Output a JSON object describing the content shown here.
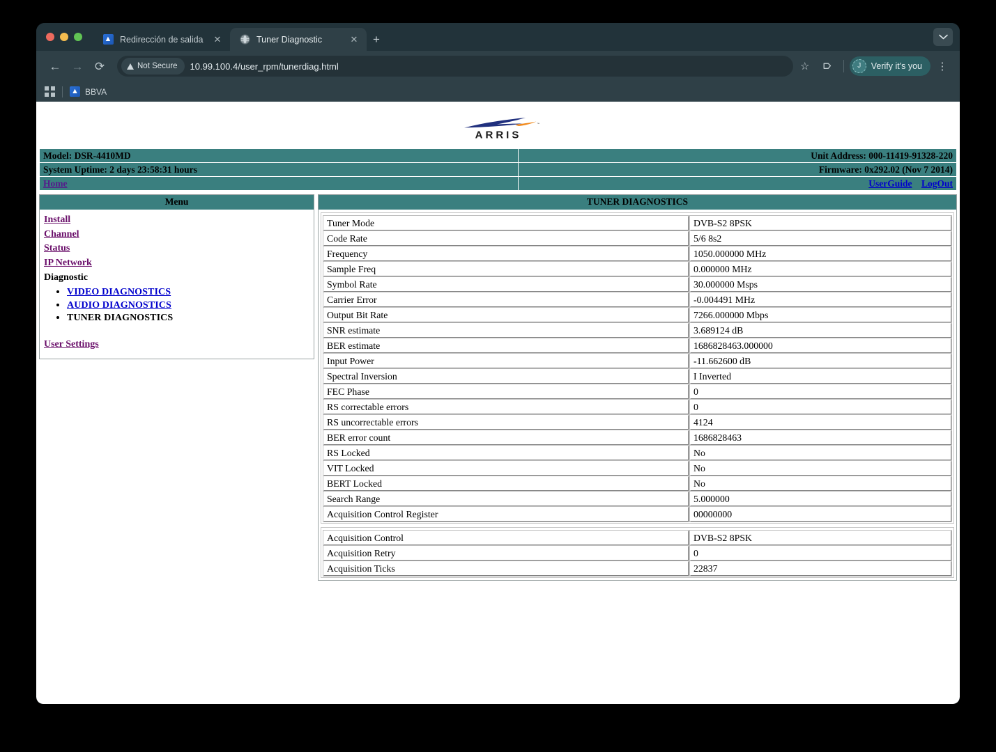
{
  "browser": {
    "tabs": [
      {
        "title": "Redirección de salida",
        "favicon": "bbva-icon",
        "active": false,
        "close_label": "✕"
      },
      {
        "title": "Tuner Diagnostic",
        "favicon": "globe-icon",
        "active": true,
        "close_label": "✕"
      }
    ],
    "new_tab_label": "+",
    "tabstrip_chevron": "⌄",
    "toolbar": {
      "back": "←",
      "forward": "→",
      "reload": "⟳",
      "security_label": "Not Secure",
      "url": "10.99.100.4/user_rpm/tunerdiag.html",
      "bookmark_star": "☆",
      "extensions": "❐",
      "profile_initial": "J",
      "profile_label": "Verify it's you",
      "menu": "⋮"
    },
    "bookmarks": {
      "apps_label": "apps-grid-icon",
      "items": [
        {
          "label": "BBVA",
          "favicon": "bbva-icon"
        }
      ]
    }
  },
  "page": {
    "logo": {
      "text": "ARRIS",
      "trademark": "™"
    },
    "info": {
      "model": "Model: DSR-4410MD",
      "unit_address": "Unit Address: 000-11419-91328-220",
      "uptime": "System Uptime: 2 days 23:58:31 hours",
      "firmware": "Firmware: 0x292.02 (Nov 7 2014)",
      "home": "Home",
      "user_guide": "UserGuide",
      "logout": "LogOut"
    },
    "menu": {
      "title": "Menu",
      "links": [
        {
          "label": "Install",
          "type": "link"
        },
        {
          "label": "Channel",
          "type": "link"
        },
        {
          "label": "Status",
          "type": "link"
        },
        {
          "label": "IP Network",
          "type": "link"
        }
      ],
      "diagnostic_heading": "Diagnostic",
      "diagnostic_items": [
        {
          "label": "VIDEO DIAGNOSTICS",
          "current": false
        },
        {
          "label": "AUDIO DIAGNOSTICS",
          "current": false
        },
        {
          "label": "TUNER DIAGNOSTICS",
          "current": true
        }
      ],
      "user_settings": "User Settings"
    },
    "diagnostics": {
      "title": "TUNER DIAGNOSTICS",
      "rows_primary": [
        {
          "key": "Tuner Mode",
          "value": "DVB-S2 8PSK"
        },
        {
          "key": "Code Rate",
          "value": "5/6 8s2"
        },
        {
          "key": "Frequency",
          "value": "1050.000000 MHz"
        },
        {
          "key": "Sample Freq",
          "value": "0.000000 MHz"
        },
        {
          "key": "Symbol Rate",
          "value": "30.000000 Msps"
        },
        {
          "key": "Carrier Error",
          "value": "-0.004491 MHz"
        },
        {
          "key": "Output Bit Rate",
          "value": "7266.000000 Mbps"
        },
        {
          "key": "SNR estimate",
          "value": "3.689124 dB"
        },
        {
          "key": "BER estimate",
          "value": "1686828463.000000"
        },
        {
          "key": "Input Power",
          "value": "-11.662600 dB"
        },
        {
          "key": "Spectral Inversion",
          "value": "I Inverted"
        },
        {
          "key": "FEC Phase",
          "value": "0"
        },
        {
          "key": "RS correctable errors",
          "value": "0"
        },
        {
          "key": "RS uncorrectable errors",
          "value": "4124"
        },
        {
          "key": "BER error count",
          "value": "1686828463"
        },
        {
          "key": "RS Locked",
          "value": "No"
        },
        {
          "key": "VIT Locked",
          "value": "No"
        },
        {
          "key": "BERT Locked",
          "value": "No"
        },
        {
          "key": "Search Range",
          "value": "5.000000"
        },
        {
          "key": "Acquisition Control Register",
          "value": "00000000"
        }
      ],
      "rows_secondary": [
        {
          "key": "Acquisition Control",
          "value": "DVB-S2 8PSK"
        },
        {
          "key": "Acquisition Retry",
          "value": "0"
        },
        {
          "key": "Acquisition Ticks",
          "value": "22837"
        }
      ]
    }
  },
  "colors": {
    "teal": "#3a7f7f",
    "link_visited": "#6a0f6a",
    "link_blue": "#0000cc",
    "chrome_dark": "#2f4047",
    "tabstrip": "#22333a",
    "logo_blue": "#20307e",
    "logo_orange": "#f08a1e"
  }
}
